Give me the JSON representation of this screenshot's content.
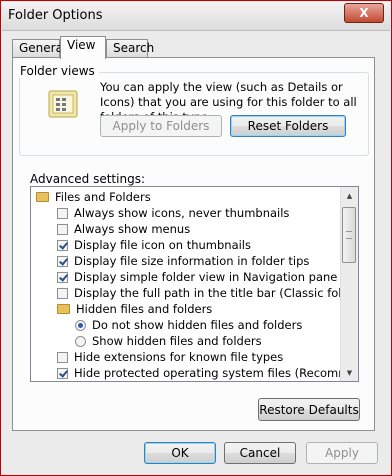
{
  "window": {
    "title": "Folder Options",
    "close_glyph": "X"
  },
  "tabs": [
    "General",
    "View",
    "Search"
  ],
  "folder_views": {
    "title": "Folder views",
    "description": "You can apply the view (such as Details or Icons) that you are using for this folder to all folders of this type.",
    "apply_label": "Apply to Folders",
    "reset_label": "Reset Folders"
  },
  "advanced": {
    "label": "Advanced settings:",
    "items": [
      {
        "kind": "folder",
        "text": "Files and Folders"
      },
      {
        "kind": "checkbox",
        "checked": false,
        "text": "Always show icons, never thumbnails"
      },
      {
        "kind": "checkbox",
        "checked": false,
        "text": "Always show menus"
      },
      {
        "kind": "checkbox",
        "checked": true,
        "text": "Display file icon on thumbnails"
      },
      {
        "kind": "checkbox",
        "checked": true,
        "text": "Display file size information in folder tips"
      },
      {
        "kind": "checkbox",
        "checked": true,
        "text": "Display simple folder view in Navigation pane"
      },
      {
        "kind": "checkbox",
        "checked": false,
        "text": "Display the full path in the title bar (Classic folders only)"
      },
      {
        "kind": "folder",
        "text": "Hidden files and folders"
      },
      {
        "kind": "radio",
        "checked": true,
        "text": "Do not show hidden files and folders"
      },
      {
        "kind": "radio",
        "checked": false,
        "text": "Show hidden files and folders"
      },
      {
        "kind": "checkbox",
        "checked": false,
        "text": "Hide extensions for known file types"
      },
      {
        "kind": "checkbox",
        "checked": true,
        "text": "Hide protected operating system files (Recommended)"
      }
    ]
  },
  "restore_label": "Restore Defaults",
  "buttons": {
    "ok": "OK",
    "cancel": "Cancel",
    "apply": "Apply"
  }
}
